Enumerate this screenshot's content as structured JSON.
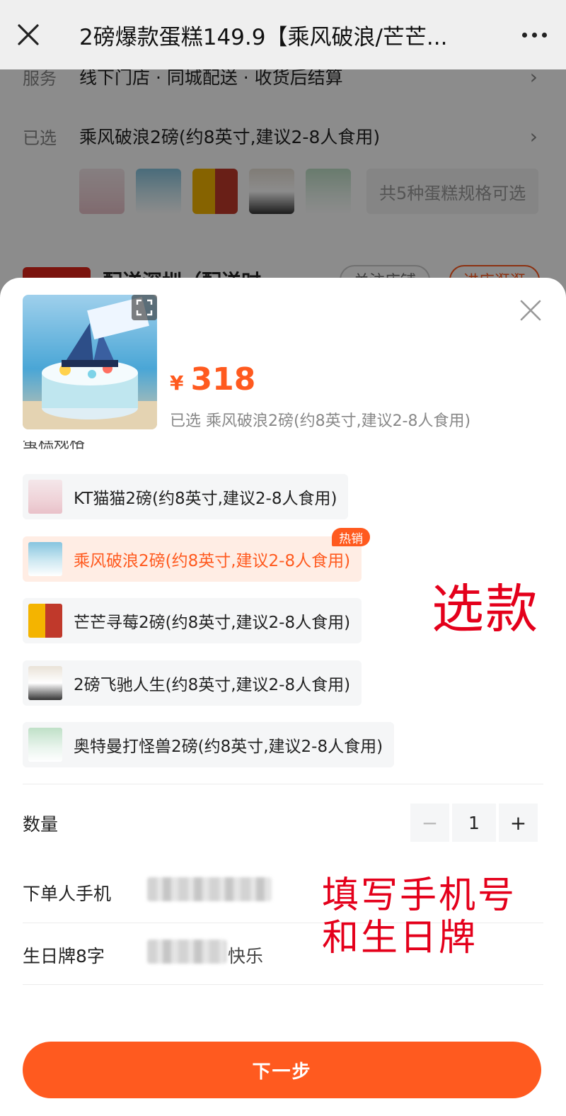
{
  "topbar": {
    "title": "2磅爆款蛋糕149.9【乘风破浪/芒芒..."
  },
  "background": {
    "service_label": "服务",
    "service_value": "线下门店 · 同城配送 · 收货后结算",
    "selected_label": "已选",
    "selected_value": "乘风破浪2磅(约8英寸,建议2-8人食用)",
    "variants_count": "共5种蛋糕规格可选",
    "delivery_title": "配送深圳（配送时",
    "follow_button": "关注店铺",
    "enter_button": "进店逛逛"
  },
  "sheet": {
    "currency": "¥",
    "price": "318",
    "selected_line": "已选 乘风破浪2磅(约8英寸,建议2-8人食用)",
    "section_title": "蛋糕规格",
    "options": [
      {
        "label": "KT猫猫2磅(约8英寸,建议2-8人食用)",
        "active": false
      },
      {
        "label": "乘风破浪2磅(约8英寸,建议2-8人食用)",
        "active": true,
        "badge": "热销"
      },
      {
        "label": "芒芒寻莓2磅(约8英寸,建议2-8人食用)",
        "active": false
      },
      {
        "label": "2磅飞驰人生(约8英寸,建议2-8人食用)",
        "active": false
      },
      {
        "label": "奥特曼打怪兽2磅(约8英寸,建议2-8人食用)",
        "active": false
      }
    ],
    "quantity_label": "数量",
    "quantity_value": "1",
    "minus": "−",
    "plus": "+",
    "phone_label": "下单人手机",
    "plaque_label": "生日牌8字",
    "plaque_suffix": "快乐",
    "next_button": "下一步"
  },
  "annotations": {
    "choose": "选款",
    "fill_line1": "填写手机号",
    "fill_line2": "和生日牌"
  },
  "colors": {
    "accent": "#ff5a1f",
    "active_bg": "#ffede4",
    "annotation_red": "#e4001b"
  }
}
